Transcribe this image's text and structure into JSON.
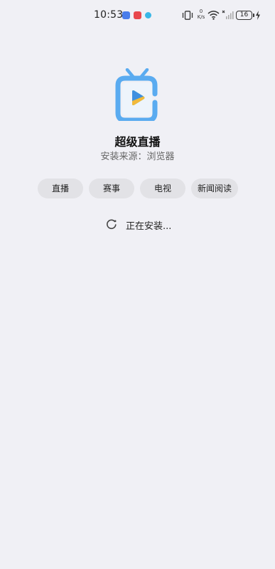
{
  "status_bar": {
    "time": "10:53",
    "net_speed_value": "0",
    "net_speed_unit": "K/s",
    "battery": "16",
    "icons": [
      "vibrate-icon",
      "wifi-icon",
      "signal-icon",
      "battery-icon",
      "charging-icon"
    ]
  },
  "app": {
    "name": "超级直播",
    "source_label": "安装来源：",
    "source_value": "浏览器",
    "icon": "tv-app-icon"
  },
  "tags": [
    "直播",
    "赛事",
    "电视",
    "新闻阅读"
  ],
  "progress": {
    "text": "正在安装..."
  },
  "colors": {
    "background": "#f0f0f5",
    "icon_blue": "#5aabf0",
    "tag_background": "#e2e2e6"
  }
}
